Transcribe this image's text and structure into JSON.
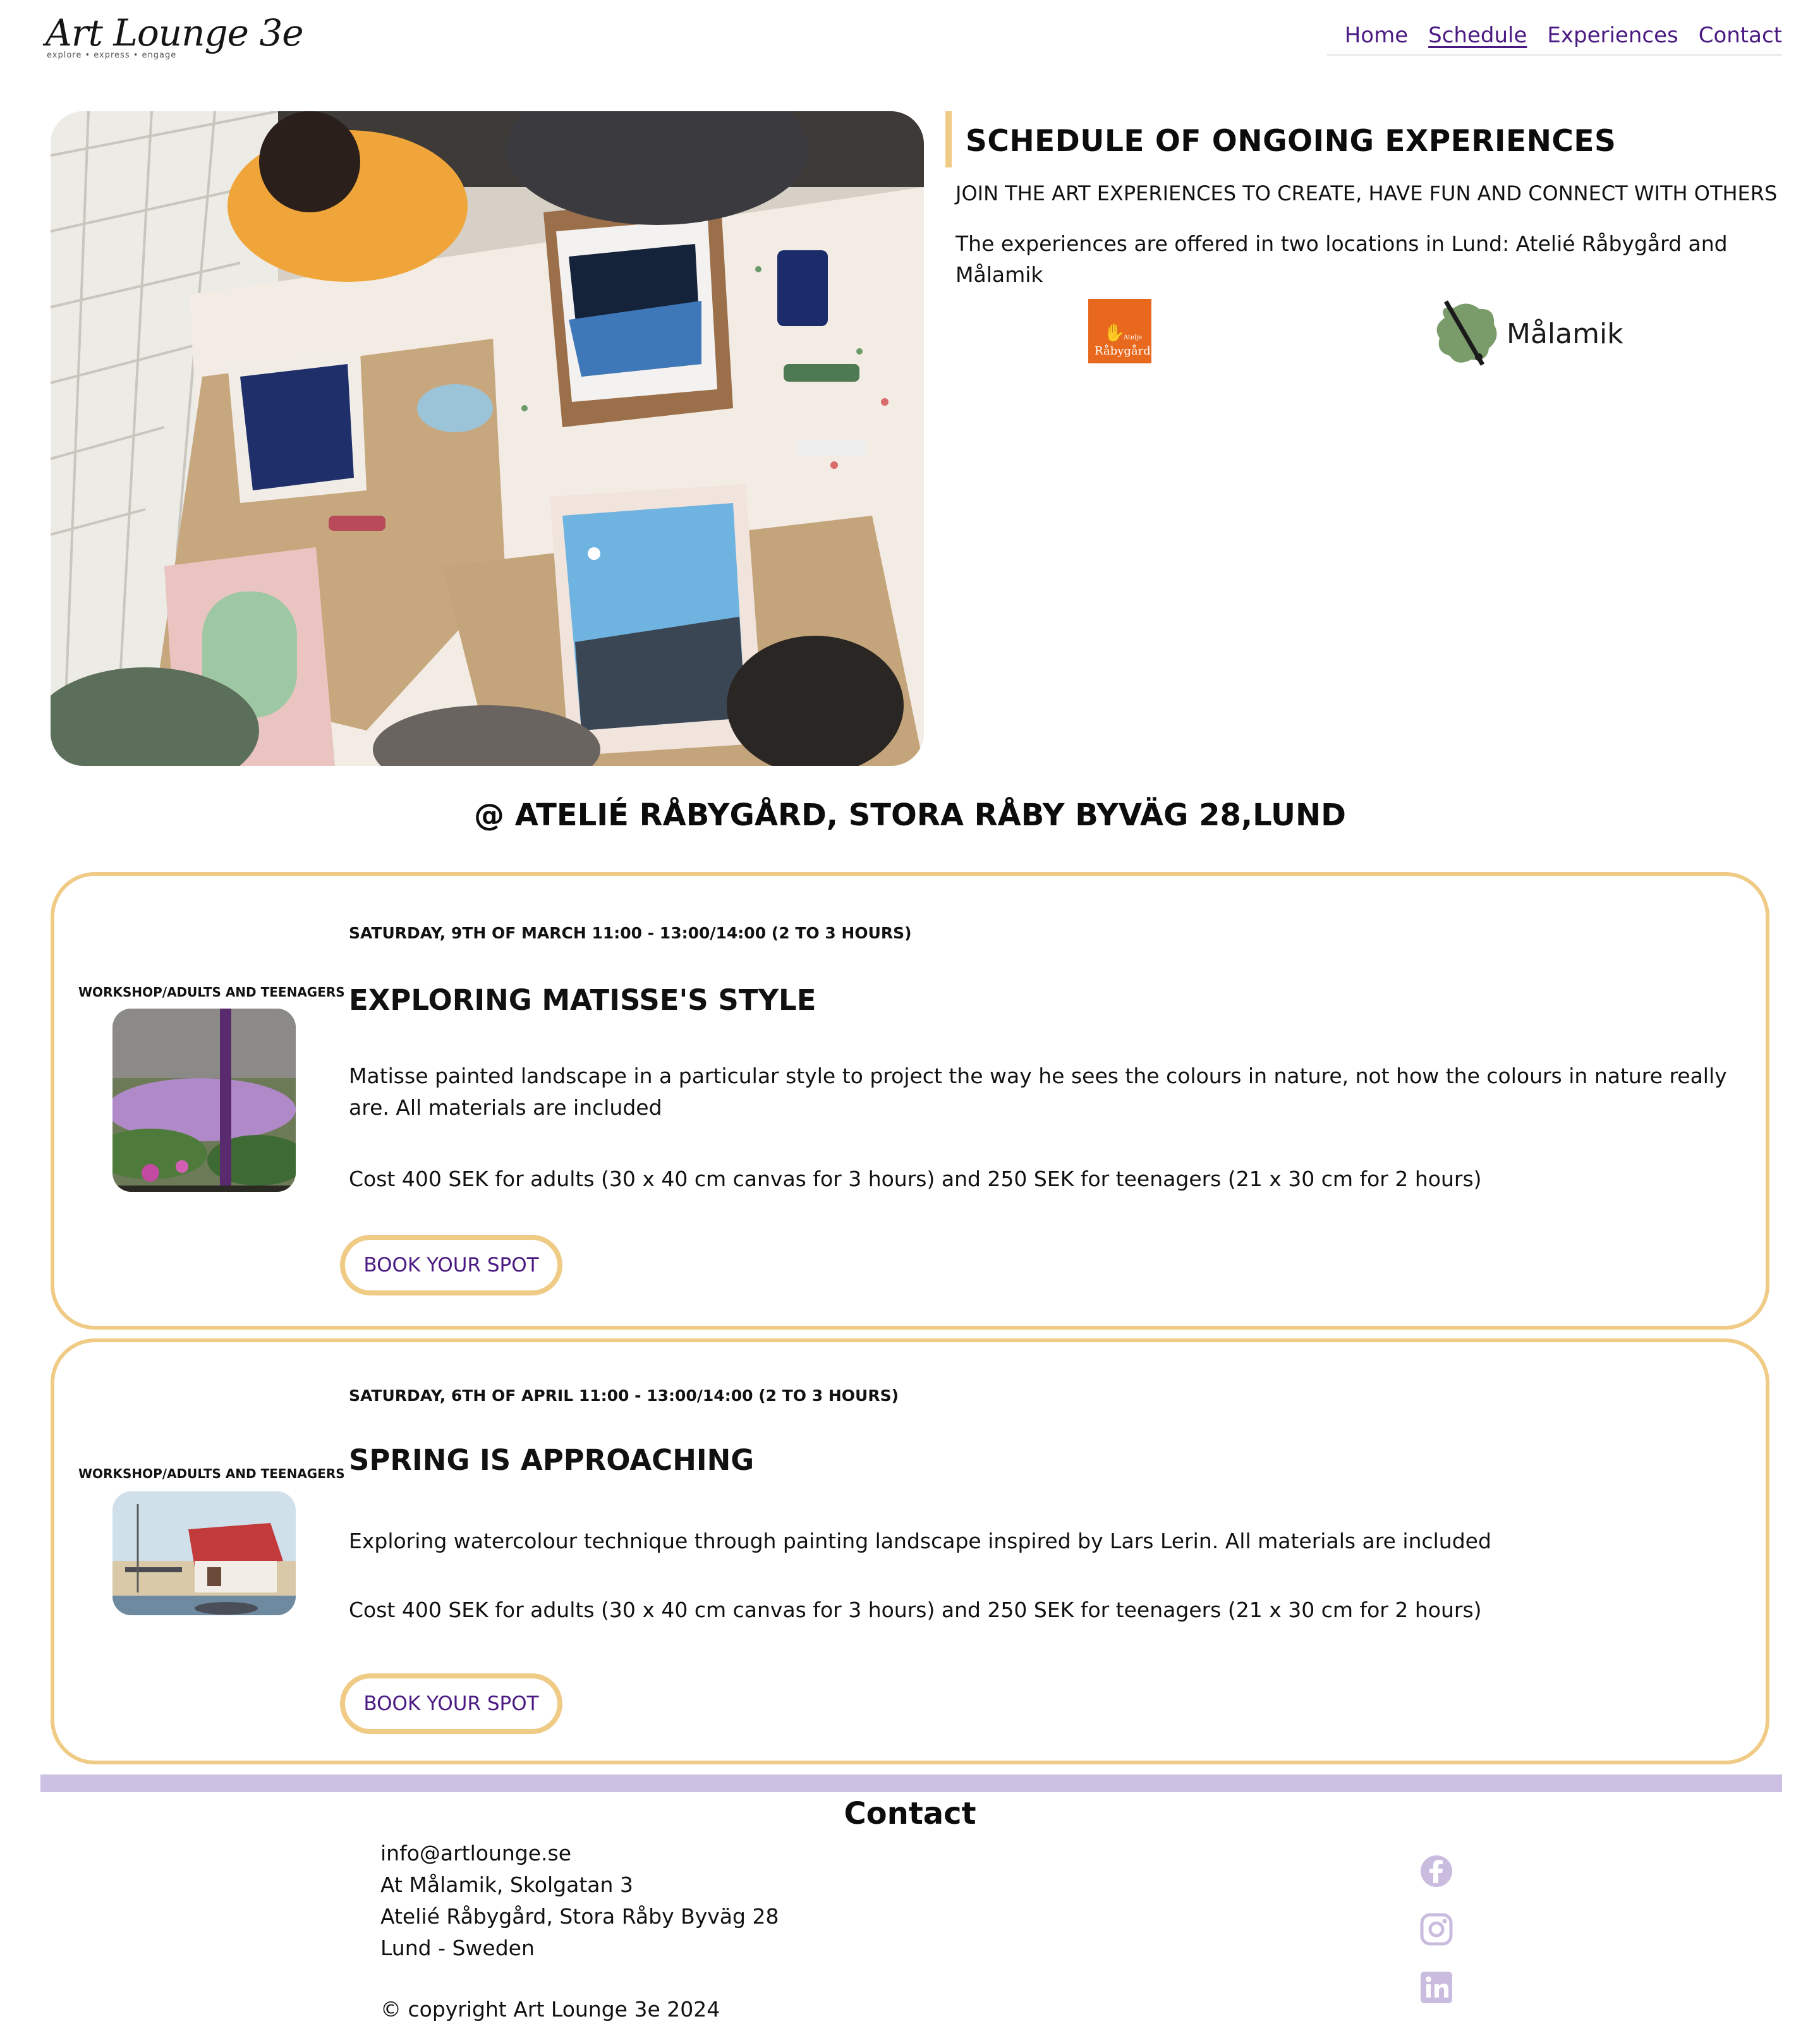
{
  "header": {
    "logo_text": "Art Lounge 3e",
    "logo_tagline": "explore • express • engage",
    "nav": [
      {
        "label": "Home"
      },
      {
        "label": "Schedule"
      },
      {
        "label": "Experiences"
      },
      {
        "label": "Contact"
      }
    ],
    "active_nav": "Schedule"
  },
  "hero": {
    "title": "SCHEDULE OF ONGOING EXPERIENCES",
    "subtitle": "JOIN THE ART EXPERIENCES TO CREATE, HAVE FUN AND CONNECT WITH OTHERS",
    "description": "The experiences are offered in two locations in Lund: Atelié Råbygård and Målamik",
    "logos": {
      "rabygard_small": "Atelje",
      "rabygard_name": "Råbygård",
      "malamik_name": "Målamik"
    }
  },
  "location_heading": "@ ATELIÉ RÅBYGÅRD, STORA RÅBY BYVÄG 28,LUND",
  "events": [
    {
      "category": "WORKSHOP/ADULTS AND TEENAGERS",
      "date": "SATURDAY, 9TH OF MARCH 11:00 - 13:00/14:00 (2 TO 3 HOURS)",
      "title": "EXPLORING MATISSE'S STYLE",
      "description": "Matisse painted landscape in a particular style to project the way he sees the colours in nature, not how the colours in nature really are. All materials are included",
      "cost": "Cost 400 SEK for adults (30 x 40 cm canvas for 3 hours) and 250 SEK for teenagers (21 x 30 cm for 2 hours)",
      "button": "BOOK YOUR SPOT"
    },
    {
      "category": "WORKSHOP/ADULTS AND TEENAGERS",
      "date": "SATURDAY, 6TH OF APRIL 11:00 - 13:00/14:00 (2 TO 3 HOURS)",
      "title": "SPRING IS APPROACHING",
      "description": "Exploring watercolour technique through painting landscape inspired by Lars Lerin. All materials are included",
      "cost": "Cost 400 SEK for adults (30 x 40 cm canvas for 3 hours) and 250 SEK for teenagers (21 x 30 cm for 2 hours)",
      "button": "BOOK YOUR SPOT"
    }
  ],
  "footer": {
    "title": "Contact",
    "lines": [
      "info@artlounge.se",
      "At Målamik, Skolgatan 3",
      "Atelié Råbygård, Stora Råby Byväg 28",
      "Lund - Sweden"
    ],
    "copyright": "© copyright Art Lounge 3e 2024",
    "social": [
      "facebook-icon",
      "instagram-icon",
      "linkedin-icon"
    ]
  },
  "colors": {
    "accent_border": "#efcb86",
    "nav_link": "#4a1a82",
    "footer_bar": "#cdc1e3",
    "social_icon": "#c9bcdf",
    "rabygard_orange": "#e8691e"
  }
}
